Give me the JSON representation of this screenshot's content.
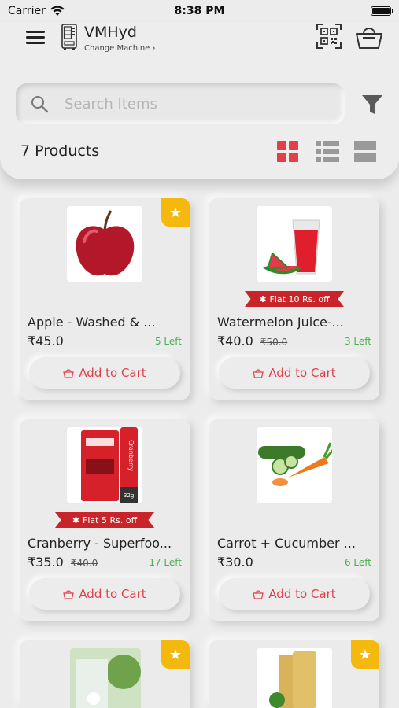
{
  "status_bar": {
    "carrier": "Carrier",
    "time": "8:38 PM"
  },
  "header": {
    "machine_name": "VMHyd",
    "change_machine": "Change Machine ›"
  },
  "search": {
    "placeholder": "Search Items"
  },
  "products_count": "7 Products",
  "colors": {
    "accent": "#e0404a",
    "star": "#f5b80c",
    "stock": "#4caf50",
    "ribbon": "#c8242a"
  },
  "products": [
    {
      "name": "Apple - Washed & ...",
      "price": "₹45.0",
      "old_price": "",
      "stock": "5 Left",
      "offer": "",
      "starred": true,
      "add_label": "Add to Cart",
      "image": "apple"
    },
    {
      "name": "Watermelon Juice-...",
      "price": "₹40.0",
      "old_price": "₹50.0",
      "stock": "3 Left",
      "offer": "Flat 10 Rs. off",
      "starred": false,
      "add_label": "Add to Cart",
      "image": "watermelon-juice"
    },
    {
      "name": "Cranberry - Superfoo...",
      "price": "₹35.0",
      "old_price": "₹40.0",
      "stock": "17 Left",
      "offer": "Flat 5 Rs. off",
      "starred": false,
      "add_label": "Add to Cart",
      "image": "cranberry-bar"
    },
    {
      "name": "Carrot + Cucumber ...",
      "price": "₹30.0",
      "old_price": "",
      "stock": "6 Left",
      "offer": "",
      "starred": false,
      "add_label": "Add to Cart",
      "image": "carrot-cucumber"
    },
    {
      "name": "",
      "price": "",
      "old_price": "",
      "stock": "",
      "offer": "",
      "starred": true,
      "add_label": "",
      "image": "coconut-water"
    },
    {
      "name": "",
      "price": "",
      "old_price": "",
      "stock": "",
      "offer": "",
      "starred": true,
      "add_label": "",
      "image": "crackers"
    }
  ]
}
